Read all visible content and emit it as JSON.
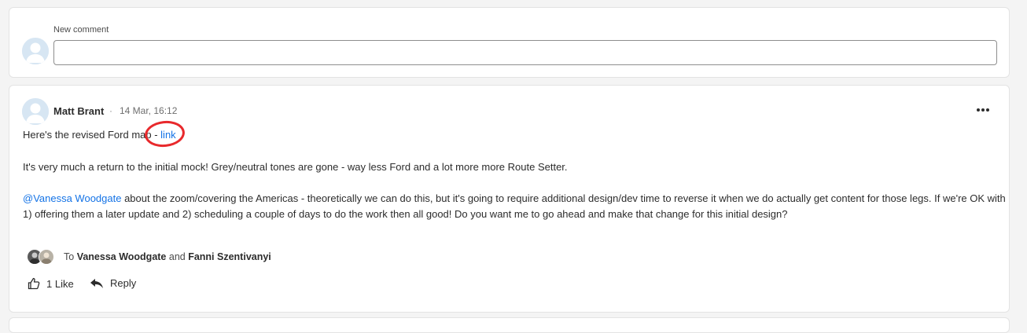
{
  "new_comment": {
    "label": "New comment",
    "input_value": "",
    "placeholder": ""
  },
  "post": {
    "author": "Matt Brant",
    "separator": "·",
    "timestamp": "14 Mar, 16:12",
    "more_icon": "more-horizontal-icon",
    "line1_prefix": "Here's the revised Ford map - ",
    "line1_link": "link",
    "line2": "It's very much a return to the initial mock! Grey/neutral tones are gone - way less Ford and a lot more more Route Setter.",
    "mention": "@Vanessa Woodgate",
    "line3_rest": " about the zoom/covering the Americas - theoretically we can do this, but it's going to require additional design/dev time to reverse it when we do actually get content for those legs. If we're OK with",
    "line4": "1) offering them a later update and 2) scheduling a couple of days to do the work then all good! Do you want me to go ahead and make that change for this initial design?",
    "to_prefix": "To ",
    "recipient1": "Vanessa Woodgate",
    "to_and": " and ",
    "recipient2": "Fanni Szentivanyi",
    "like_label": "1 Like",
    "reply_label": "Reply",
    "annotation_color": "#e8292c",
    "link_color": "#1473e6"
  }
}
